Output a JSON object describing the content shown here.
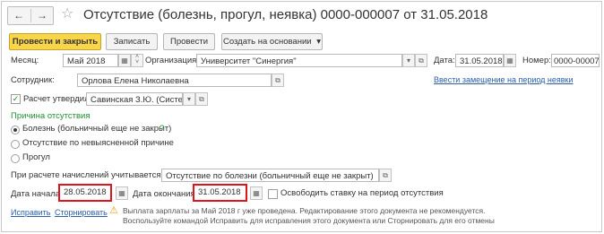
{
  "header": {
    "back_icon": "←",
    "forward_icon": "→",
    "star_icon": "☆",
    "title": "Отсутствие (болезнь, прогул, неявка) 0000-000007 от 31.05.2018"
  },
  "toolbar": {
    "post_and_close": "Провести и закрыть",
    "save": "Записать",
    "post": "Провести",
    "create_based_on": "Создать на основании",
    "dropdown_icon": "▾"
  },
  "row_month": {
    "month_label": "Месяц:",
    "month_value": "Май 2018",
    "org_label": "Организация:",
    "org_value": "Университет \"Синергия\"",
    "date_label": "Дата:",
    "date_value": "31.05.2018",
    "number_label": "Номер:",
    "number_value": "0000-00007"
  },
  "row_employee": {
    "label": "Сотрудник:",
    "value": "Орлова Елена Николаевна",
    "replacement_link": "Ввести замещение на период неявки"
  },
  "row_approved": {
    "label": "Расчет утвердил",
    "value": "Савинская З.Ю. (Систем"
  },
  "reason": {
    "section_label": "Причина отсутствия",
    "options": [
      "Болезнь (больничный еще не закрыт)",
      "Отсутствие по невыясненной причине",
      "Прогул"
    ],
    "help": "?"
  },
  "row_accruals": {
    "label": "При расчете начислений учитывается как:",
    "value": "Отсутствие по болезни (больничный еще не закрыт)"
  },
  "row_dates": {
    "start_label": "Дата начала:",
    "start_value": "28.05.2018",
    "end_label": "Дата окончания:",
    "end_value": "31.05.2018",
    "free_rate_label": "Освободить ставку на период отсутствия"
  },
  "footer": {
    "fix_link": "Исправить",
    "reverse_link": "Сторнировать",
    "warning_icon": "⚠",
    "warning_line1": "Выплата зарплаты за Май 2018 г уже проведена. Редактирование этого документа не рекомендуется.",
    "warning_line2": "Воспользуйте командой Исправить для исправления этого документа или Сторнировать для его отмены"
  },
  "icons": {
    "calendar": "▦",
    "open": "⧉",
    "more": "...",
    "select": "▾",
    "up": "˄",
    "down": "˅",
    "check": "✓"
  },
  "colors": {
    "primary_button": "#f9d54a",
    "link": "#2a5ea8",
    "section_label": "#1f8f34",
    "highlight": "#e0141c"
  }
}
